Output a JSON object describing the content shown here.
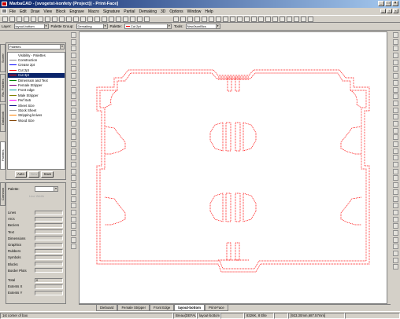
{
  "window": {
    "title": "MarbaCAD - [svogetst-konfety (Project)] - Print-Face]"
  },
  "menu": [
    "File",
    "Edit",
    "Draw",
    "View",
    "Block",
    "Engrave",
    "Macro",
    "Signature",
    "Partial",
    "Demaking",
    "3D",
    "Options",
    "Window",
    "Help"
  ],
  "toolbar2": {
    "layer_label": "Layer:",
    "layer_value": "layout-bottom",
    "palette_group_label": "Palette Group:",
    "palette_group_value": "Demaking",
    "palette_label": "Palette:",
    "palette_value": "Cut 2pt",
    "tools_label": "Tools:",
    "tools_value": "New2sonBlcs"
  },
  "palettes_panel": {
    "header": "Palettes",
    "items": [
      {
        "label": "Visibility - Palettes",
        "color": "#000000"
      },
      {
        "label": "Construction",
        "color": "#808080"
      },
      {
        "label": "Crease 2pt",
        "color": "#0000ff"
      },
      {
        "label": "Cut 2pt",
        "color": "#ff0000"
      },
      {
        "label": "Cut 3pt",
        "color": "#ff0000"
      },
      {
        "label": "Dimension and Text",
        "color": "#008000"
      },
      {
        "label": "Female Stripper",
        "color": "#800080"
      },
      {
        "label": "Front edge",
        "color": "#00a0a0"
      },
      {
        "label": "Male Stripper",
        "color": "#808000"
      },
      {
        "label": "Perf 6x6",
        "color": "#ff00ff"
      },
      {
        "label": "Sheet Size",
        "color": "#000080"
      },
      {
        "label": "Stock Sheet",
        "color": "#a0a0a0"
      },
      {
        "label": "Stripping knives",
        "color": "#ff8000"
      },
      {
        "label": "Wood Size",
        "color": "#804000"
      }
    ],
    "selected_index": 4,
    "btn_auto": "Auto",
    "btn_new": "New",
    "btn_save": "Save"
  },
  "vtabs": [
    "Scorer",
    "Ris. Palettes",
    "Databook",
    "Palettes"
  ],
  "properties_panel": {
    "tab_label": "Common",
    "palette_label": "Palette:",
    "line_width_label": "Line Width",
    "rows": [
      {
        "label": "Lines",
        "value": "0"
      },
      {
        "label": "Arcs",
        "value": "0"
      },
      {
        "label": "Beziers",
        "value": "0"
      },
      {
        "label": "Text",
        "value": "0"
      },
      {
        "label": "Dimensions",
        "value": "0"
      },
      {
        "label": "Graphics",
        "value": "0"
      },
      {
        "label": "Rubbers",
        "value": "0"
      },
      {
        "label": "Symbols",
        "value": "0"
      },
      {
        "label": "Blocks",
        "value": "0"
      },
      {
        "label": "Border Plots",
        "value": "0"
      }
    ],
    "total_label": "Total",
    "total_value": "0",
    "extents_x_label": "Extents X",
    "extents_y_label": "Extents Y"
  },
  "bottom_tabs": [
    "Dieboard",
    "Female Stripper",
    "Front Edge",
    "layout-bottom",
    "Print-Face"
  ],
  "active_tab_index": 3,
  "status": {
    "hint": "1st corner of box",
    "layer": "Breau(DEFAUlT)",
    "layout": "layout-bottom",
    "zoom": "8326K, 8 Elte",
    "coords": "[923.30mm,687.57mm]"
  },
  "colors": {
    "cut": "#ff0000",
    "titlebar": "#0a246a",
    "selection": "#0a246a"
  }
}
